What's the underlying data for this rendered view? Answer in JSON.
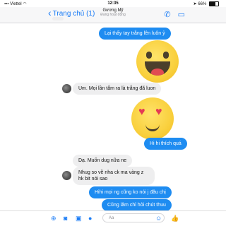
{
  "status_bar": {
    "carrier": "Viettel",
    "time": "12:35",
    "battery": "66%",
    "battery_level": 0.66
  },
  "header": {
    "back_label": "Trang chủ (1)",
    "contact_name": "Gương Mỹ",
    "contact_status": "Đang hoạt động"
  },
  "messages": [
    {
      "direction": "outgoing",
      "text": "Lại thấy tay trắng lên luôn ỷ"
    },
    {
      "direction": "outgoing",
      "type": "sticker",
      "icon": "laughing-emoji"
    },
    {
      "direction": "incoming",
      "text": "Um. Mọi lần tắm ra là trắng đã luon"
    },
    {
      "direction": "outgoing",
      "type": "sticker",
      "icon": "heart-eyes-emoji"
    },
    {
      "direction": "outgoing",
      "text": "Hi hi thích quá"
    },
    {
      "direction": "incoming",
      "text": "Dạ. Muốn dug nữa ne"
    },
    {
      "direction": "incoming",
      "text": "Nhug so về nha ck ma vàng z hk bit nói sao"
    },
    {
      "direction": "outgoing",
      "text": "Hihi mọi ng cũng ko nói j đâu chị"
    },
    {
      "direction": "outgoing",
      "text": "Cũng lâm chỉ hỏi chút thuu"
    }
  ],
  "composer": {
    "placeholder": "Aa"
  },
  "colors": {
    "accent": "#1a7cf6",
    "outgoing_bubble": "#1e8cf1",
    "incoming_bubble": "#eeeeef"
  }
}
